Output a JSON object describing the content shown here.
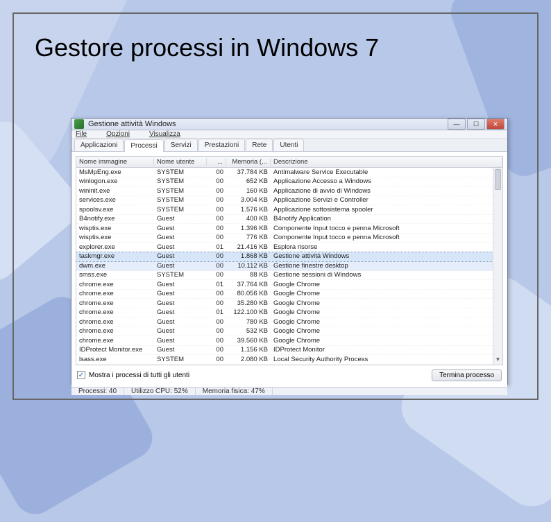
{
  "slide": {
    "title": "Gestore processi in Windows 7"
  },
  "window": {
    "title": "Gestione attività Windows",
    "menu": {
      "file": "File",
      "options": "Opzioni",
      "view": "Visualizza"
    },
    "tabs": [
      {
        "label": "Applicazioni"
      },
      {
        "label": "Processi"
      },
      {
        "label": "Servizi"
      },
      {
        "label": "Prestazioni"
      },
      {
        "label": "Rete"
      },
      {
        "label": "Utenti"
      }
    ],
    "active_tab": 1,
    "columns": {
      "image": "Nome immagine",
      "user": "Nome utente",
      "cpu": "...",
      "mem": "Memoria (...",
      "desc": "Descrizione"
    },
    "rows": [
      {
        "img": "MsMpEng.exe",
        "user": "SYSTEM",
        "cpu": "00",
        "mem": "37.784 KB",
        "desc": "Antimalware Service Executable"
      },
      {
        "img": "winlogon.exe",
        "user": "SYSTEM",
        "cpu": "00",
        "mem": "652 KB",
        "desc": "Applicazione Accesso a Windows"
      },
      {
        "img": "wininit.exe",
        "user": "SYSTEM",
        "cpu": "00",
        "mem": "160 KB",
        "desc": "Applicazione di avvio di Windows"
      },
      {
        "img": "services.exe",
        "user": "SYSTEM",
        "cpu": "00",
        "mem": "3.004 KB",
        "desc": "Applicazione Servizi e Controller"
      },
      {
        "img": "spoolsv.exe",
        "user": "SYSTEM",
        "cpu": "00",
        "mem": "1.576 KB",
        "desc": "Applicazione sottosistema spooler"
      },
      {
        "img": "B4notify.exe",
        "user": "Guest",
        "cpu": "00",
        "mem": "400 KB",
        "desc": "B4notify Application"
      },
      {
        "img": "wisptis.exe",
        "user": "Guest",
        "cpu": "00",
        "mem": "1.396 KB",
        "desc": "Componente Input tocco e penna Microsoft"
      },
      {
        "img": "wisptis.exe",
        "user": "Guest",
        "cpu": "00",
        "mem": "776 KB",
        "desc": "Componente Input tocco e penna Microsoft"
      },
      {
        "img": "explorer.exe",
        "user": "Guest",
        "cpu": "01",
        "mem": "21.416 KB",
        "desc": "Esplora risorse"
      },
      {
        "img": "taskmgr.exe",
        "user": "Guest",
        "cpu": "00",
        "mem": "1.868 KB",
        "desc": "Gestione attività Windows",
        "selected": true
      },
      {
        "img": "dwm.exe",
        "user": "Guest",
        "cpu": "00",
        "mem": "10.112 KB",
        "desc": "Gestione finestre desktop",
        "highlight": true
      },
      {
        "img": "smss.exe",
        "user": "SYSTEM",
        "cpu": "00",
        "mem": "88 KB",
        "desc": "Gestione sessioni di Windows"
      },
      {
        "img": "chrome.exe",
        "user": "Guest",
        "cpu": "01",
        "mem": "37.764 KB",
        "desc": "Google Chrome"
      },
      {
        "img": "chrome.exe",
        "user": "Guest",
        "cpu": "00",
        "mem": "80.056 KB",
        "desc": "Google Chrome"
      },
      {
        "img": "chrome.exe",
        "user": "Guest",
        "cpu": "00",
        "mem": "35.280 KB",
        "desc": "Google Chrome"
      },
      {
        "img": "chrome.exe",
        "user": "Guest",
        "cpu": "01",
        "mem": "122.100 KB",
        "desc": "Google Chrome"
      },
      {
        "img": "chrome.exe",
        "user": "Guest",
        "cpu": "00",
        "mem": "780 KB",
        "desc": "Google Chrome"
      },
      {
        "img": "chrome.exe",
        "user": "Guest",
        "cpu": "00",
        "mem": "532 KB",
        "desc": "Google Chrome"
      },
      {
        "img": "chrome.exe",
        "user": "Guest",
        "cpu": "00",
        "mem": "39.560 KB",
        "desc": "Google Chrome"
      },
      {
        "img": "IDProtect Monitor.exe",
        "user": "Guest",
        "cpu": "00",
        "mem": "1.156 KB",
        "desc": "IDProtect Monitor"
      },
      {
        "img": "lsass.exe",
        "user": "SYSTEM",
        "cpu": "00",
        "mem": "2.080 KB",
        "desc": "Local Security Authority Process"
      }
    ],
    "show_all_label": "Mostra i processi di tutti gli utenti",
    "end_process_label": "Termina processo",
    "status": {
      "processes_label": "Processi: 40",
      "cpu_label": "Utilizzo CPU: 52%",
      "mem_label": "Memoria fisica: 47%"
    }
  }
}
